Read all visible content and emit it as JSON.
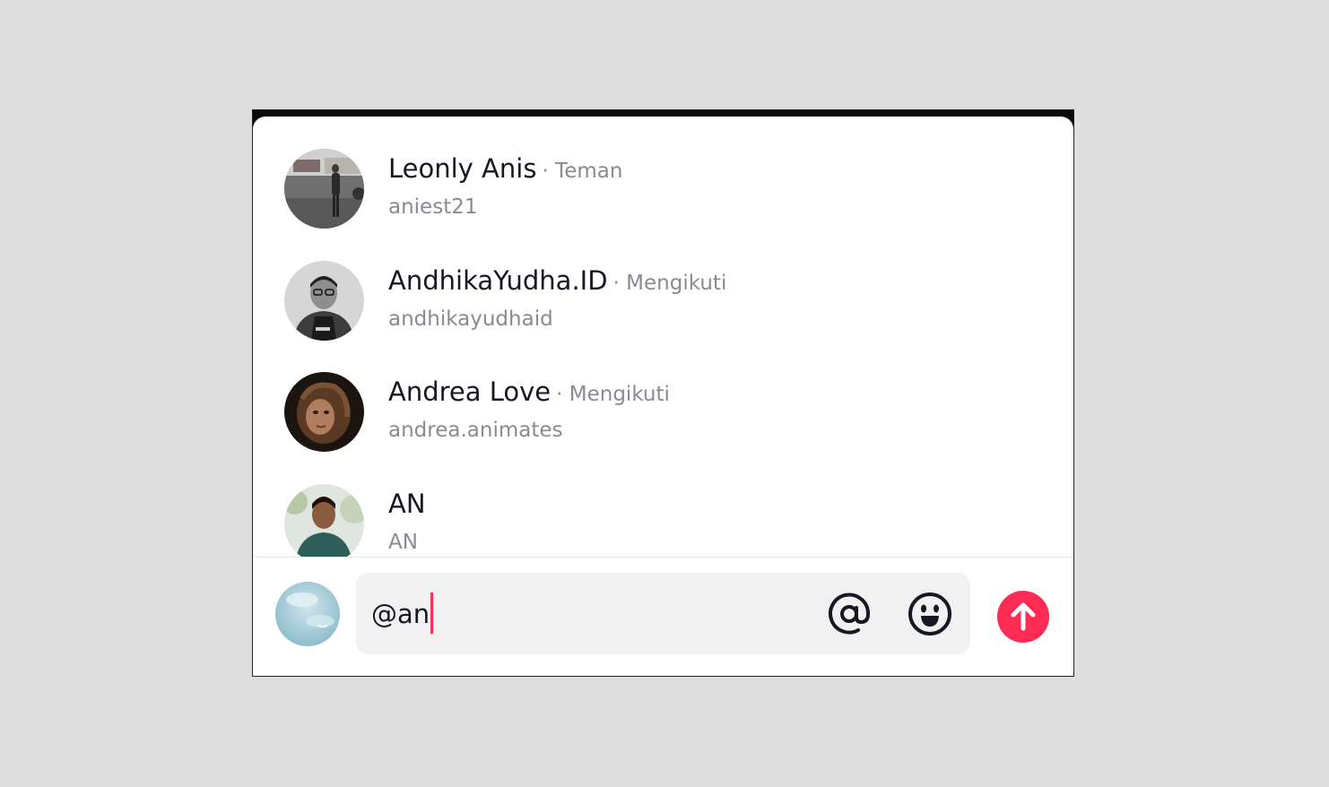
{
  "mentions": [
    {
      "name": "Leonly Anis",
      "relation": "· Teman",
      "handle": "aniest21"
    },
    {
      "name": "AndhikaYudha.ID",
      "relation": "· Mengikuti",
      "handle": "andhikayudhaid"
    },
    {
      "name": "Andrea Love",
      "relation": "· Mengikuti",
      "handle": "andrea.animates"
    },
    {
      "name": "AN",
      "relation": "",
      "handle": "AN"
    }
  ],
  "composer": {
    "input_value": "@an",
    "mention_icon": "at-sign-icon",
    "emoji_icon": "emoji-icon",
    "send_icon": "arrow-up-icon"
  },
  "colors": {
    "accent": "#fe2c55",
    "primary_text": "#161823",
    "secondary_text": "#8a8b91",
    "input_bg": "#f1f1f2"
  }
}
